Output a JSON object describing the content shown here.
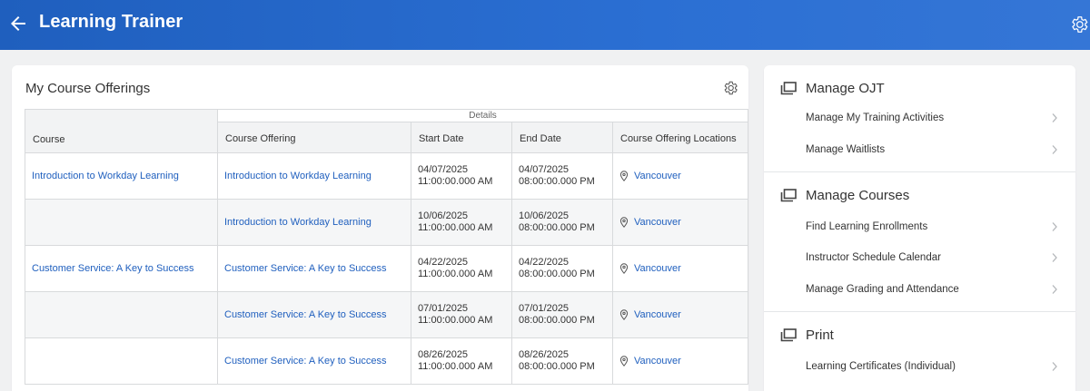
{
  "header": {
    "title": "Learning Trainer"
  },
  "offerings": {
    "title": "My Course Offerings",
    "group_header": "Details",
    "columns": {
      "course": "Course",
      "offering": "Course Offering",
      "start": "Start Date",
      "end": "End Date",
      "locations": "Course Offering Locations"
    },
    "rows": [
      {
        "course": "Introduction to Workday Learning",
        "offering": "Introduction to Workday Learning",
        "start_date": "04/07/2025",
        "start_time": "11:00:00.000 AM",
        "end_date": "04/07/2025",
        "end_time": "08:00:00.000 PM",
        "location": "Vancouver"
      },
      {
        "course": "",
        "offering": "Introduction to Workday Learning",
        "start_date": "10/06/2025",
        "start_time": "11:00:00.000 AM",
        "end_date": "10/06/2025",
        "end_time": "08:00:00.000 PM",
        "location": "Vancouver"
      },
      {
        "course": "Customer Service: A Key to Success",
        "offering": "Customer Service: A Key to Success",
        "start_date": "04/22/2025",
        "start_time": "11:00:00.000 AM",
        "end_date": "04/22/2025",
        "end_time": "08:00:00.000 PM",
        "location": "Vancouver"
      },
      {
        "course": "",
        "offering": "Customer Service: A Key to Success",
        "start_date": "07/01/2025",
        "start_time": "11:00:00.000 AM",
        "end_date": "07/01/2025",
        "end_time": "08:00:00.000 PM",
        "location": "Vancouver"
      },
      {
        "course": "",
        "offering": "Customer Service: A Key to Success",
        "start_date": "08/26/2025",
        "start_time": "11:00:00.000 AM",
        "end_date": "08/26/2025",
        "end_time": "08:00:00.000 PM",
        "location": "Vancouver"
      }
    ]
  },
  "sidebar": {
    "sections": [
      {
        "title": "Manage OJT",
        "items": [
          "Manage My Training Activities",
          "Manage Waitlists"
        ]
      },
      {
        "title": "Manage Courses",
        "items": [
          "Find Learning Enrollments",
          "Instructor Schedule Calendar",
          "Manage Grading and Attendance"
        ]
      },
      {
        "title": "Print",
        "items": [
          "Learning Certificates (Individual)"
        ]
      }
    ]
  },
  "icons": {
    "back": "arrow-left-icon",
    "header_settings": "gear-icon",
    "table_settings": "gear-icon",
    "location": "map-pin-icon",
    "section": "windows-stack-icon",
    "item": "chevron-right-icon"
  },
  "colors": {
    "header": "#2b6fd3",
    "link": "#1f5fbe",
    "background": "#f0f1f2"
  }
}
